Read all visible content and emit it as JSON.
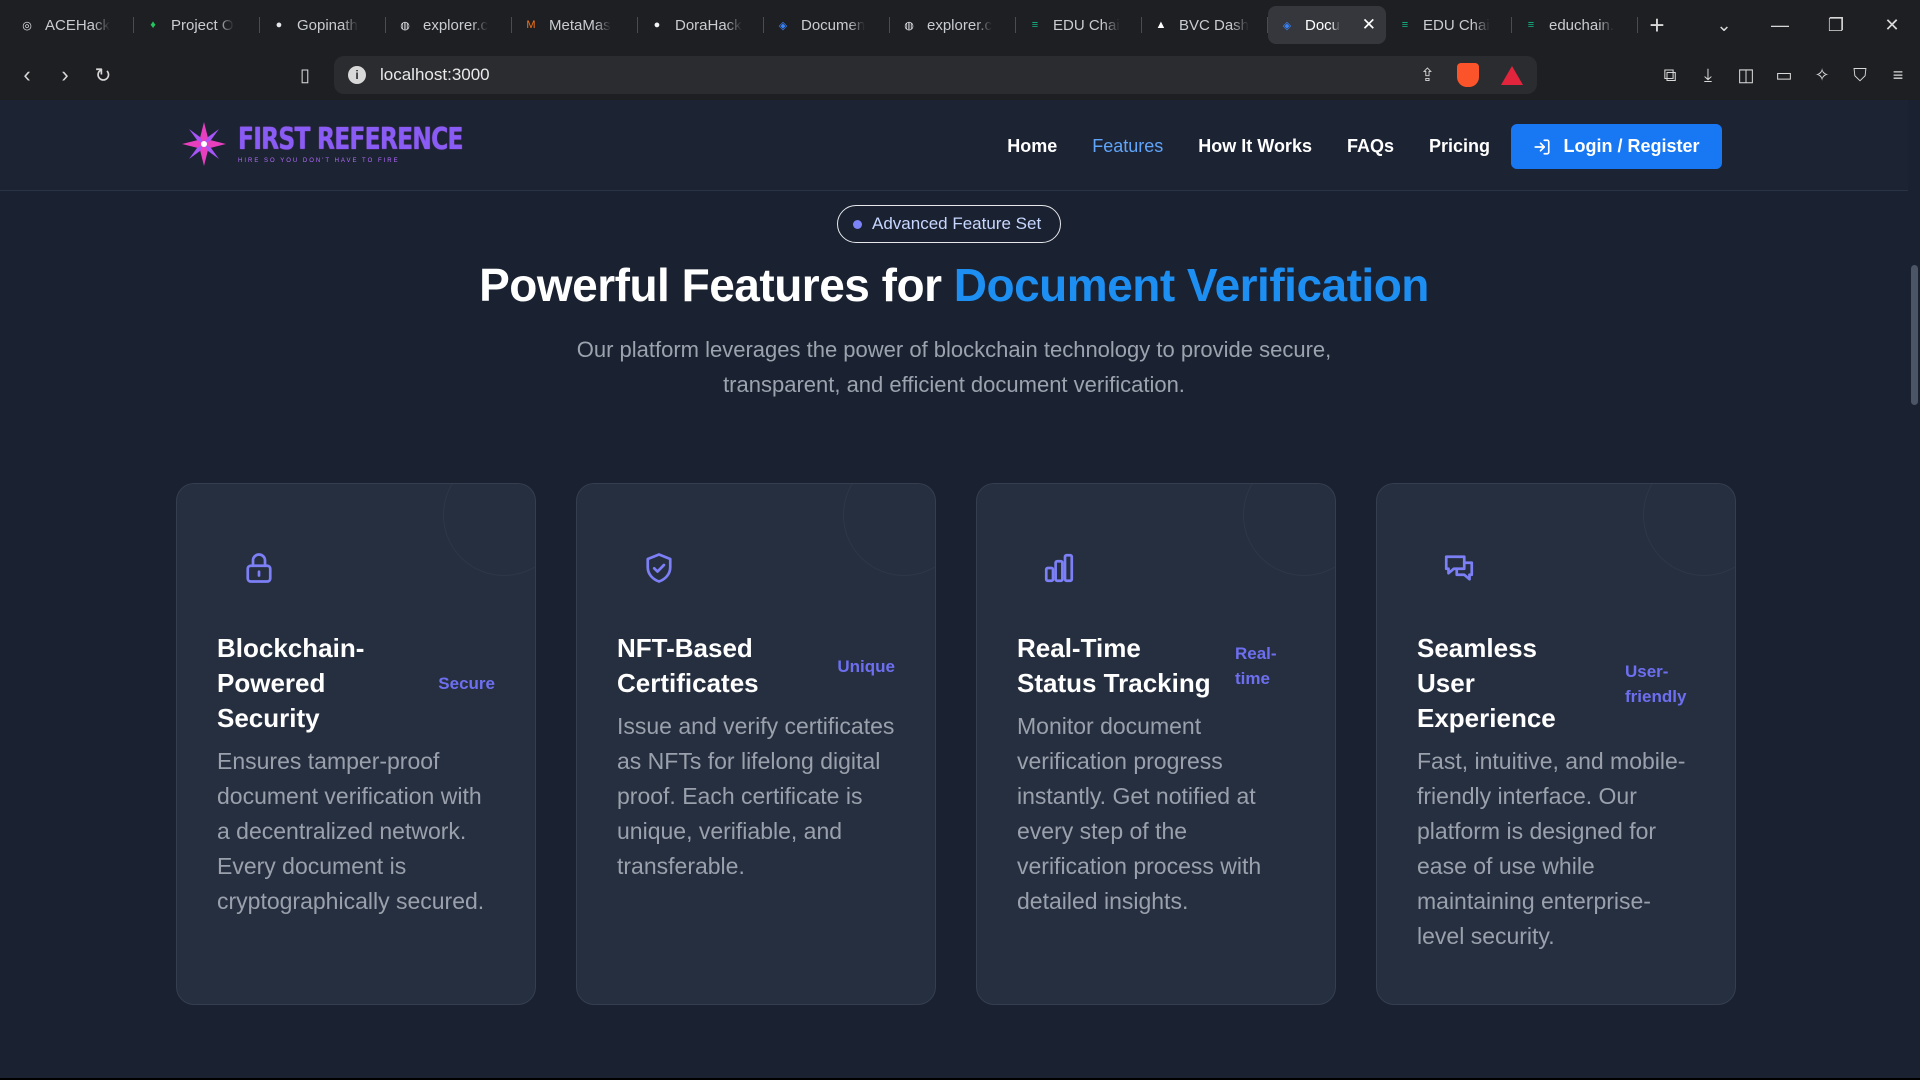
{
  "browser": {
    "tabs": [
      {
        "title": "ACEHack",
        "icon": "ace-icon",
        "color": "#e5e7eb"
      },
      {
        "title": "Project O",
        "icon": "leaf-icon",
        "color": "#22c55e"
      },
      {
        "title": "Gopinath",
        "icon": "github-icon",
        "color": "#e5e7eb"
      },
      {
        "title": "explorer.c",
        "icon": "globe-icon",
        "color": "#e5e7eb"
      },
      {
        "title": "MetaMas",
        "icon": "metamask-icon",
        "color": "#f97316"
      },
      {
        "title": "DoraHack",
        "icon": "dorahacks-icon",
        "color": "#f3f4f6"
      },
      {
        "title": "Documen",
        "icon": "doc-app-icon",
        "color": "#3b82f6"
      },
      {
        "title": "explorer.c",
        "icon": "globe-icon",
        "color": "#e5e7eb"
      },
      {
        "title": "EDU Chai",
        "icon": "educhain-icon",
        "color": "#10b981"
      },
      {
        "title": "BVC Dash",
        "icon": "bvc-icon",
        "color": "#ffffff"
      },
      {
        "title": "Docu",
        "icon": "doc-app-icon",
        "color": "#3b82f6",
        "active": true
      },
      {
        "title": "EDU Chai",
        "icon": "educhain-icon",
        "color": "#10b981"
      },
      {
        "title": "educhain.",
        "icon": "educhain-icon",
        "color": "#10b981"
      }
    ],
    "url": "localhost:3000"
  },
  "site": {
    "logo": {
      "title": "FIRST REFERENCE",
      "tagline": "HIRE SO YOU DON'T HAVE TO FIRE"
    },
    "nav": [
      {
        "label": "Home",
        "active": false
      },
      {
        "label": "Features",
        "active": true
      },
      {
        "label": "How It Works",
        "active": false
      },
      {
        "label": "FAQs",
        "active": false
      },
      {
        "label": "Pricing",
        "active": false
      }
    ],
    "login_label": "Login / Register"
  },
  "hero": {
    "badge": "Advanced Feature Set",
    "title_prefix": "Powerful Features for ",
    "title_highlight": "Document Verification",
    "subtitle": "Our platform leverages the power of blockchain technology to provide secure, transparent, and efficient document verification."
  },
  "features": [
    {
      "icon": "lock-icon",
      "title": "Blockchain-Powered Security",
      "tag": "Secure",
      "desc": "Ensures tamper-proof document verification with a decentralized network. Every document is cryptographically secured."
    },
    {
      "icon": "shield-check-icon",
      "title": "NFT-Based Certificates",
      "tag": "Unique",
      "desc": "Issue and verify certificates as NFTs for lifelong digital proof. Each certificate is unique, verifiable, and transferable."
    },
    {
      "icon": "bar-chart-icon",
      "title": "Real-Time Status Tracking",
      "tag": "Real-time",
      "desc": "Monitor document verification progress instantly. Get notified at every step of the verification process with detailed insights."
    },
    {
      "icon": "chat-icon",
      "title": "Seamless User Experience",
      "tag": "User-friendly",
      "desc": "Fast, intuitive, and mobile-friendly interface. Our platform is designed for ease of use while maintaining enterprise-level security."
    }
  ],
  "colors": {
    "accent": "#1877f2",
    "highlight": "#1d8ff2",
    "tag": "#6d6ff0",
    "background": "#1a2130",
    "card": "#262f3f"
  }
}
